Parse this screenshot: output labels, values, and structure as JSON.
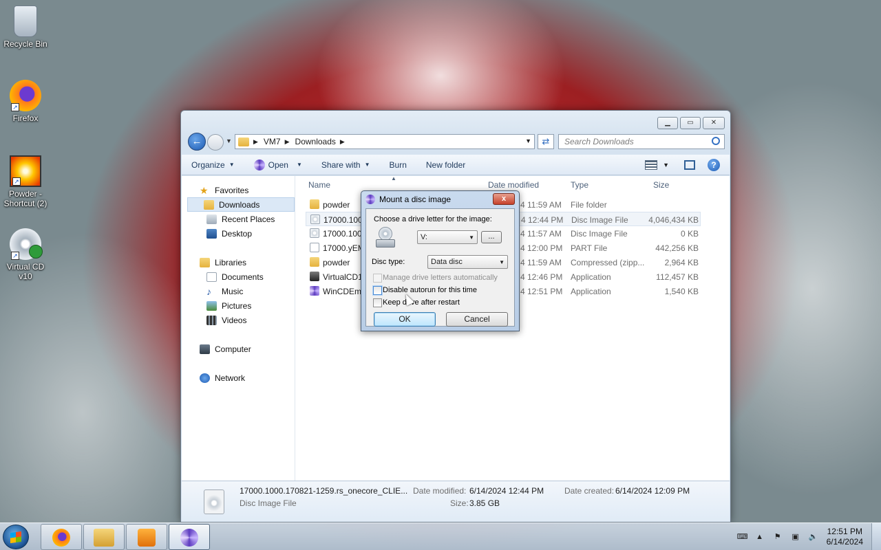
{
  "desktop": {
    "icons": [
      {
        "label": "Recycle Bin"
      },
      {
        "label": "Firefox"
      },
      {
        "label": "Powder - Shortcut (2)"
      },
      {
        "label": "Virtual CD v10"
      }
    ]
  },
  "explorer": {
    "breadcrumb": [
      "VM7",
      "Downloads"
    ],
    "search_placeholder": "Search Downloads",
    "toolbar": {
      "organize": "Organize",
      "open": "Open",
      "share_with": "Share with",
      "burn": "Burn",
      "new_folder": "New folder"
    },
    "nav": {
      "favorites": "Favorites",
      "downloads": "Downloads",
      "recent_places": "Recent Places",
      "desktop": "Desktop",
      "libraries": "Libraries",
      "documents": "Documents",
      "music": "Music",
      "pictures": "Pictures",
      "videos": "Videos",
      "computer": "Computer",
      "network": "Network"
    },
    "columns": {
      "name": "Name",
      "date": "Date modified",
      "type": "Type",
      "size": "Size"
    },
    "files": [
      {
        "name": "powder",
        "date": "4 11:59 AM",
        "type": "File folder",
        "size": "",
        "icon": "folder"
      },
      {
        "name": "17000.1000",
        "date": "4 12:44 PM",
        "type": "Disc Image File",
        "size": "4,046,434 KB",
        "icon": "disc"
      },
      {
        "name": "17000.1000",
        "date": "4 11:57 AM",
        "type": "Disc Image File",
        "size": "0 KB",
        "icon": "disc"
      },
      {
        "name": "17000.yEM",
        "date": "4 12:00 PM",
        "type": "PART File",
        "size": "442,256 KB",
        "icon": "file"
      },
      {
        "name": "powder",
        "date": "4 11:59 AM",
        "type": "Compressed (zipp...",
        "size": "2,964 KB",
        "icon": "folder"
      },
      {
        "name": "VirtualCD1",
        "date": "4 12:46 PM",
        "type": "Application",
        "size": "112,457 KB",
        "icon": "app"
      },
      {
        "name": "WinCDEm",
        "date": "4 12:51 PM",
        "type": "Application",
        "size": "1,540 KB",
        "icon": "wincd"
      }
    ],
    "details": {
      "filename": "17000.1000.170821-1259.rs_onecore_CLIE...",
      "filetype": "Disc Image File",
      "date_modified_label": "Date modified:",
      "date_modified": "6/14/2024 12:44 PM",
      "date_created_label": "Date created:",
      "date_created": "6/14/2024 12:09 PM",
      "size_label": "Size:",
      "size": "3.85 GB"
    }
  },
  "dialog": {
    "title": "Mount a disc image",
    "close_label": "x",
    "prompt": "Choose a drive letter for the image:",
    "drive_letter": "V:",
    "browse_label": "...",
    "disc_type_label": "Disc type:",
    "disc_type": "Data disc",
    "opt_manage": "Manage drive letters automatically",
    "opt_autorun": "Disable autorun for this time",
    "opt_keep": "Keep drive after restart",
    "ok": "OK",
    "cancel": "Cancel"
  },
  "taskbar": {
    "time": "12:51 PM",
    "date": "6/14/2024"
  }
}
